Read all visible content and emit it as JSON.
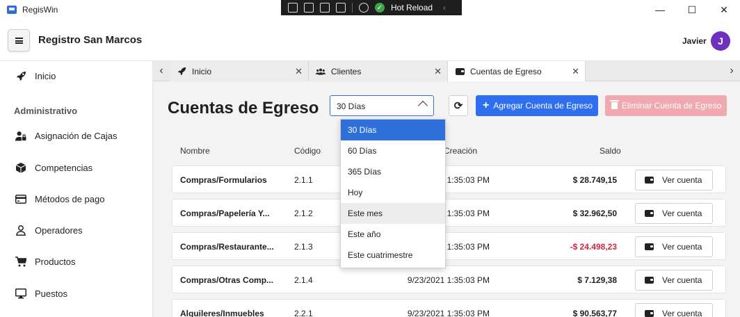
{
  "window": {
    "title": "RegisWin",
    "hot_reload_label": "Hot Reload",
    "minimize": "—",
    "maximize": "☐",
    "close": "✕"
  },
  "header": {
    "org_title": "Registro San Marcos",
    "user_name": "Javier",
    "avatar_initial": "J"
  },
  "sidebar": {
    "home": "Inicio",
    "section": "Administrativo",
    "items": [
      {
        "label": "Asignación de Cajas",
        "icon": "user-lock-icon"
      },
      {
        "label": "Competencias",
        "icon": "cube-icon"
      },
      {
        "label": "Métodos de pago",
        "icon": "credit-card-icon"
      },
      {
        "label": "Operadores",
        "icon": "user-icon"
      },
      {
        "label": "Productos",
        "icon": "cart-icon"
      },
      {
        "label": "Puestos",
        "icon": "monitor-icon"
      }
    ]
  },
  "tabs": [
    {
      "label": "Inicio",
      "icon": "rocket-icon",
      "close": "✕"
    },
    {
      "label": "Clientes",
      "icon": "users-icon",
      "close": "✕"
    },
    {
      "label": "Cuentas de Egreso",
      "icon": "wallet-icon",
      "close": "✕"
    }
  ],
  "page": {
    "title": "Cuentas de Egreso",
    "period_value": "30 Días",
    "add_button": "Agregar Cuenta de Egreso",
    "delete_button": "Eliminar Cuenta de Egreso"
  },
  "table": {
    "headers": {
      "name": "Nombre",
      "code": "Código",
      "created": "Creación",
      "balance": "Saldo"
    },
    "view_label": "Ver cuenta",
    "rows": [
      {
        "name": "Compras/Formularios",
        "code": "2.1.1",
        "created": "1:35:03 PM",
        "balance": "$ 28.749,15",
        "negative": false
      },
      {
        "name": "Compras/Papelería Y...",
        "code": "2.1.2",
        "created": "1:35:03 PM",
        "balance": "$ 32.962,50",
        "negative": false
      },
      {
        "name": "Compras/Restaurante...",
        "code": "2.1.3",
        "created": "1:35:03 PM",
        "balance": "-$ 24.498,23",
        "negative": true
      },
      {
        "name": "Compras/Otras Comp...",
        "code": "2.1.4",
        "created": "9/23/2021 1:35:03 PM",
        "balance": "$ 7.129,38",
        "negative": false
      },
      {
        "name": "Alquileres/Inmuebles",
        "code": "2.2.1",
        "created": "9/23/2021 1:35:03 PM",
        "balance": "$ 90.563,77",
        "negative": false
      }
    ]
  },
  "dropdown": {
    "options": [
      "30 Días",
      "60 Días",
      "365 Días",
      "Hoy",
      "Este mes",
      "Este año",
      "Este cuatrimestre"
    ],
    "selected_index": 0,
    "hover_index": 4
  },
  "colors": {
    "accent": "#2e6ff0",
    "danger_disabled": "#f0a9ae",
    "negative": "#d3283b",
    "avatar": "#6f2fbf"
  }
}
